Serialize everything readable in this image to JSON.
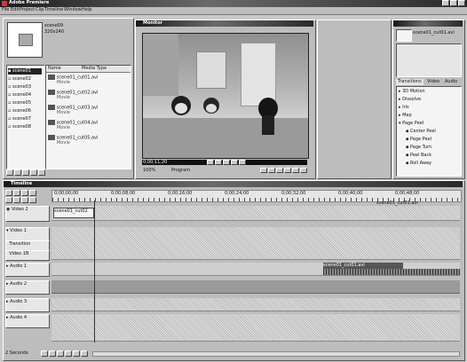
{
  "app": {
    "title": "Adobe Premiere"
  },
  "menu": [
    "File",
    "Edit",
    "Project",
    "Clip",
    "Timeline",
    "Window",
    "Help"
  ],
  "project": {
    "preview_name": "scene09",
    "preview_info": "320x240",
    "bins": [
      "scene01",
      "scene02",
      "scene03",
      "scene04",
      "scene05",
      "scene06",
      "scene07",
      "scene08"
    ],
    "col_headers": [
      "Name",
      "Media Type"
    ],
    "clips": [
      {
        "name": "scene01_cut01.avi",
        "info": "Movie"
      },
      {
        "name": "scene01_cut02.avi",
        "info": "Movie"
      },
      {
        "name": "scene01_cut03.avi",
        "info": "Movie"
      },
      {
        "name": "scene01_cut04.avi",
        "info": "Movie"
      },
      {
        "name": "scene01_cut05.avi",
        "info": "Movie"
      }
    ]
  },
  "monitor": {
    "title": "Monitor",
    "timecode": "0;00;11;20",
    "zoom": "100%",
    "status": "Program"
  },
  "transitions": {
    "tabs": [
      "Transitions",
      "Video",
      "Audio"
    ],
    "header": "scene01_cut01.avi",
    "tree": [
      "3D Motion",
      "Dissolve",
      "Iris",
      "Map",
      "Page Peel",
      "Center Peel",
      "Page Peel",
      "Page Turn",
      "Peel Back",
      "Roll Away"
    ]
  },
  "timeline": {
    "title": "Timeline",
    "ruler_labels": [
      "0;00;00;00",
      "0;00;08;00",
      "0;00;16;00",
      "0;00;24;00",
      "0;00;32;00",
      "0;00;40;00",
      "0;00;48;00"
    ],
    "tracks": [
      "Video 2",
      "Video 1",
      "Transition",
      "Video 1B",
      "Audio 1",
      "Audio 2",
      "Audio 3",
      "Audio 4"
    ],
    "clip_labels": [
      "scene01_cut01.avi",
      "scene01_cut02",
      "scene01_cut01.avi"
    ],
    "footer": "2 Seconds"
  }
}
